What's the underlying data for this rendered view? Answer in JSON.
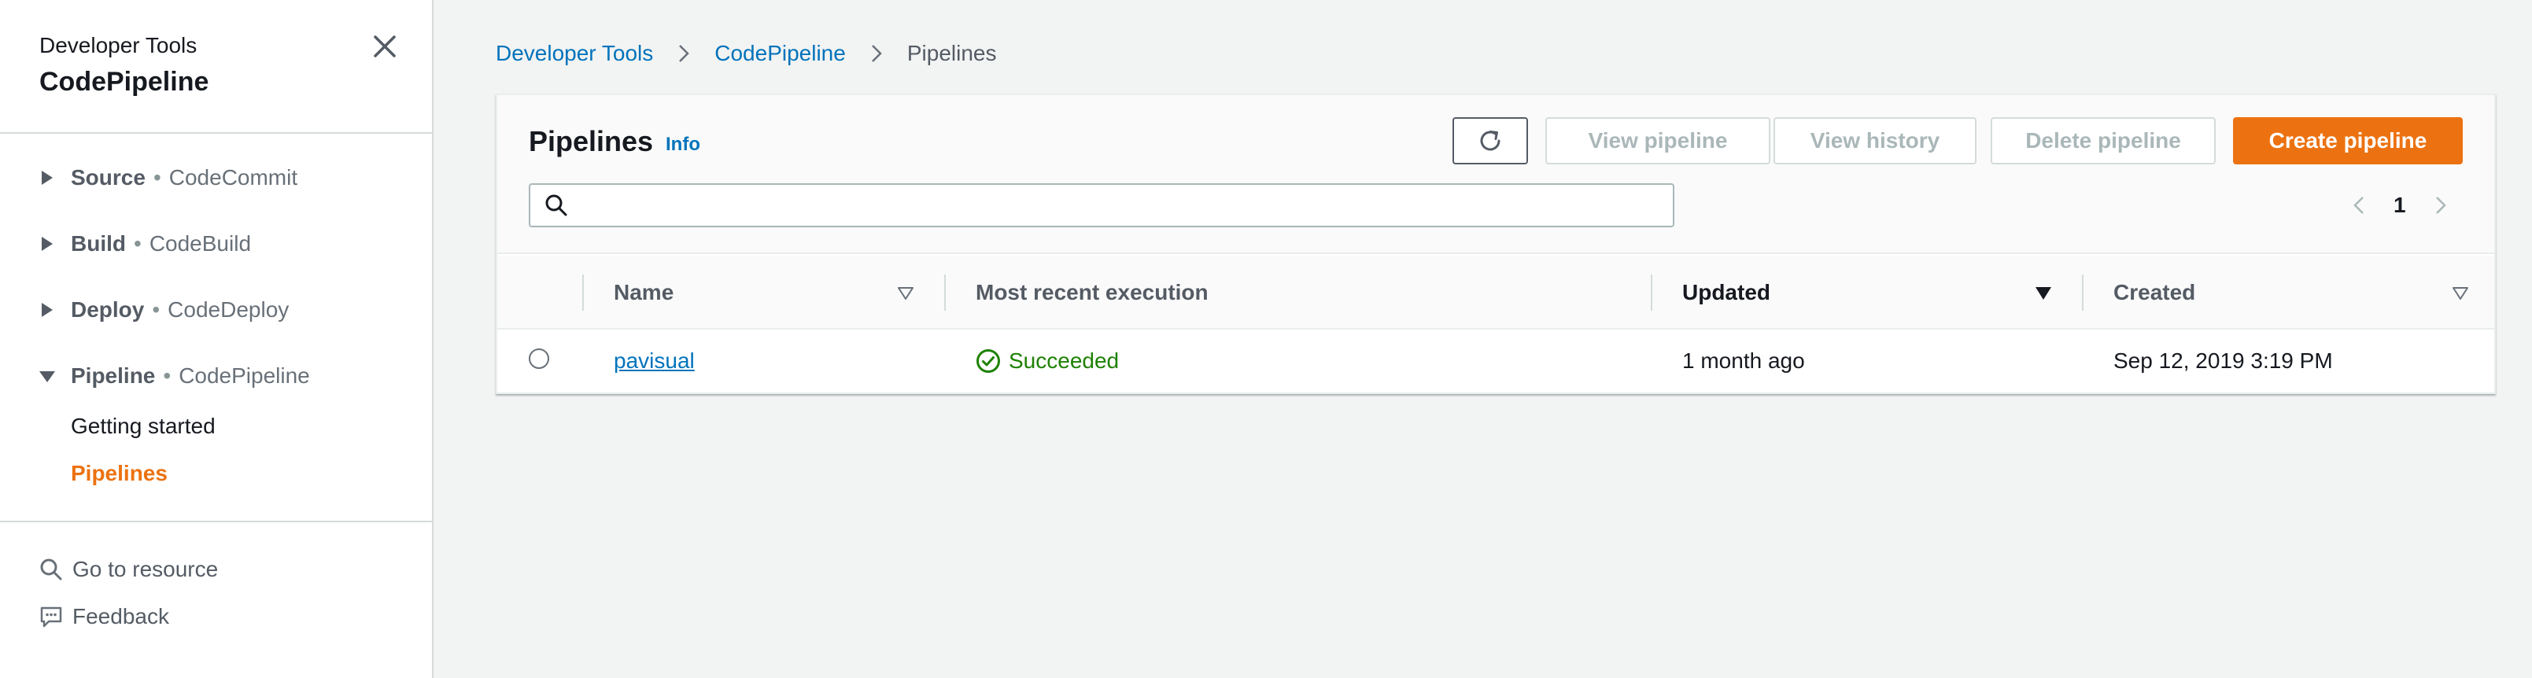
{
  "sidebar": {
    "service_group": "Developer Tools",
    "service_name": "CodePipeline",
    "sections": [
      {
        "title": "Source",
        "separator": "•",
        "subtitle": "CodeCommit",
        "expanded": false
      },
      {
        "title": "Build",
        "separator": "•",
        "subtitle": "CodeBuild",
        "expanded": false
      },
      {
        "title": "Deploy",
        "separator": "•",
        "subtitle": "CodeDeploy",
        "expanded": false
      },
      {
        "title": "Pipeline",
        "separator": "•",
        "subtitle": "CodePipeline",
        "expanded": true
      }
    ],
    "links": [
      {
        "label": "Getting started"
      },
      {
        "label": "Pipelines",
        "active": true
      }
    ],
    "footer": [
      {
        "label": "Go to resource",
        "icon": "search-icon"
      },
      {
        "label": "Feedback",
        "icon": "feedback-icon"
      }
    ]
  },
  "breadcrumb": [
    {
      "label": "Developer Tools"
    },
    {
      "label": "CodePipeline"
    },
    {
      "label": "Pipelines"
    }
  ],
  "panel": {
    "title": "Pipelines",
    "info": "Info",
    "buttons": {
      "refresh_icon": "refresh-icon",
      "view_pipeline": "View pipeline",
      "view_history": "View history",
      "delete_pipeline": "Delete pipeline",
      "create_pipeline": "Create pipeline"
    },
    "search": {
      "value": "",
      "placeholder": ""
    },
    "pagination": {
      "current_page": "1"
    }
  },
  "table": {
    "columns": [
      "Name",
      "Most recent execution",
      "Updated",
      "Created"
    ],
    "sorted_column": "Updated",
    "rows": [
      {
        "name": "pavisual",
        "execution_status": "Succeeded",
        "updated": "1 month ago",
        "created": "Sep 12, 2019 3:19 PM"
      }
    ]
  },
  "colors": {
    "accent_orange": "#ec7211",
    "link_blue": "#0073bb",
    "success_green": "#1d8102",
    "disabled_text": "#aab7b8"
  }
}
